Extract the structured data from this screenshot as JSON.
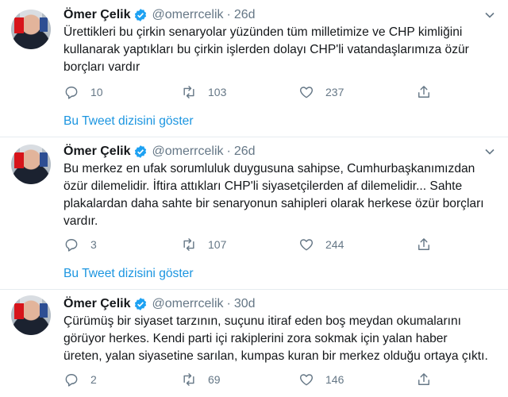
{
  "tweets": [
    {
      "name": "Ömer Çelik",
      "handle": "@omerrcelik",
      "separator": "·",
      "time": "26d",
      "lines": [
        "Ürettikleri bu çirkin senaryolar yüzünden tüm milletimize ve CHP kimliğini",
        "kullanarak yaptıkları bu çirkin işlerden dolayı CHP'li vatandaşlarımıza özür",
        "borçları vardır"
      ],
      "replies": "10",
      "retweets": "103",
      "likes": "237",
      "thread_link": "Bu Tweet dizisini göster"
    },
    {
      "name": "Ömer Çelik",
      "handle": "@omerrcelik",
      "separator": "·",
      "time": "26d",
      "lines": [
        "Bu merkez en ufak sorumluluk duygusuna sahipse, Cumhurbaşkanımızdan",
        "özür dilemelidir. İftira attıkları CHP'li siyasetçilerden af dilemelidir... Sahte",
        "plakalardan daha sahte bir senaryonun sahipleri olarak herkese özür borçları",
        "vardır."
      ],
      "replies": "3",
      "retweets": "107",
      "likes": "244",
      "thread_link": "Bu Tweet dizisini göster"
    },
    {
      "name": "Ömer Çelik",
      "handle": "@omerrcelik",
      "separator": "·",
      "time": "30d",
      "lines": [
        "Çürümüş bir siyaset tarzının, suçunu itiraf eden boş meydan okumalarını",
        "görüyor herkes. Kendi parti içi rakiplerini zora sokmak için yalan haber",
        "üreten, yalan siyasetine sarılan, kumpas kuran bir merkez olduğu ortaya çıktı."
      ],
      "replies": "2",
      "retweets": "69",
      "likes": "146"
    }
  ],
  "colors": {
    "link": "#1b95e0",
    "muted": "#657786",
    "verified": "#1da1f2",
    "divider": "#e6ecf0"
  },
  "icons": {
    "reply": "reply-icon",
    "retweet": "retweet-icon",
    "like": "heart-icon",
    "share": "share-icon",
    "more": "chevron-down-icon",
    "verified": "verified-badge-icon"
  }
}
